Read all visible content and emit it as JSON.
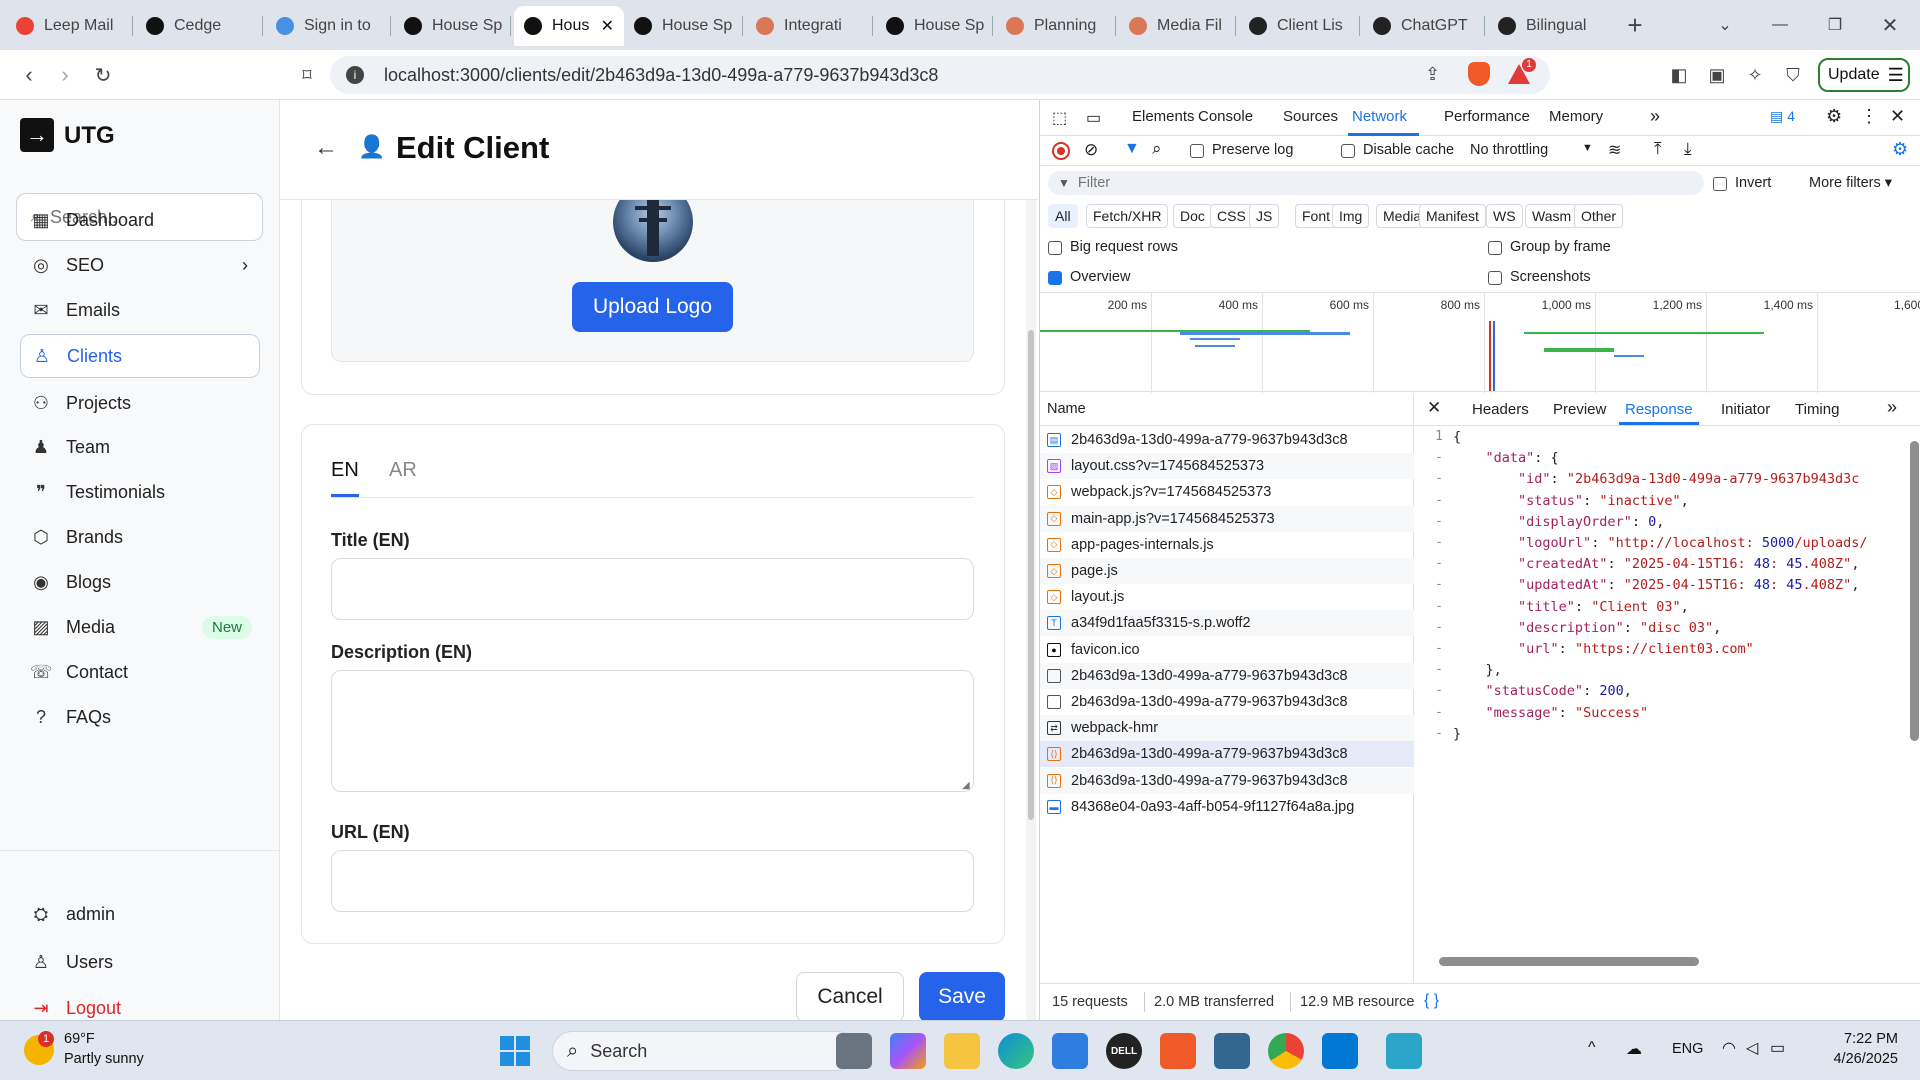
{
  "browser": {
    "tabs": [
      {
        "label": "Leep Mail",
        "icon": "gmail-icon"
      },
      {
        "label": "Cedge",
        "icon": "vercel-icon"
      },
      {
        "label": "Sign in to",
        "icon": "cloud-icon"
      },
      {
        "label": "House Sp",
        "icon": "vercel-icon"
      },
      {
        "label": "Hous",
        "icon": "vercel-icon",
        "active": true
      },
      {
        "label": "House Sp",
        "icon": "vercel-icon"
      },
      {
        "label": "Integrati",
        "icon": "claude-icon"
      },
      {
        "label": "House Sp",
        "icon": "vercel-icon"
      },
      {
        "label": "Planning",
        "icon": "claude-icon"
      },
      {
        "label": "Media Fil",
        "icon": "claude-icon"
      },
      {
        "label": "Client Lis",
        "icon": "openai-icon"
      },
      {
        "label": "ChatGPT",
        "icon": "openai-icon"
      },
      {
        "label": "Bilingual",
        "icon": "openai-icon"
      }
    ],
    "url": "localhost:3000/clients/edit/2b463d9a-13d0-499a-a779-9637b943d3c8",
    "update_label": "Update",
    "brave_badge": "1"
  },
  "sidebar": {
    "brand": "UTG",
    "search_placeholder": "Search...",
    "items": [
      {
        "label": "Dashboard",
        "icon": "grid-icon"
      },
      {
        "label": "SEO",
        "icon": "globe-icon"
      },
      {
        "label": "Emails",
        "icon": "mail-icon"
      },
      {
        "label": "Clients",
        "icon": "user-icon"
      },
      {
        "label": "Projects",
        "icon": "projects-icon"
      },
      {
        "label": "Team",
        "icon": "team-icon"
      },
      {
        "label": "Testimonials",
        "icon": "quote-icon"
      },
      {
        "label": "Brands",
        "icon": "box-icon"
      },
      {
        "label": "Blogs",
        "icon": "rss-icon"
      },
      {
        "label": "Media",
        "icon": "image-icon",
        "badge": "New"
      },
      {
        "label": "Contact",
        "icon": "contact-icon"
      },
      {
        "label": "FAQs",
        "icon": "help-icon"
      }
    ],
    "bottom": [
      {
        "label": "admin",
        "icon": "admin-icon"
      },
      {
        "label": "Users",
        "icon": "users-icon"
      },
      {
        "label": "Logout",
        "icon": "logout-icon"
      }
    ]
  },
  "main": {
    "title": "Edit Client",
    "upload_label": "Upload Logo",
    "lang_tabs": [
      "EN",
      "AR"
    ],
    "fields": [
      {
        "label": "Title (EN)",
        "value": ""
      },
      {
        "label": "Description (EN)",
        "value": ""
      },
      {
        "label": "URL (EN)",
        "value": ""
      }
    ],
    "cancel_label": "Cancel",
    "save_label": "Save"
  },
  "devtools": {
    "tabs": [
      "Elements",
      "Console",
      "Sources",
      "Network",
      "Performance",
      "Memory"
    ],
    "active_tab": "Network",
    "issues_count": "4",
    "preserve_log": "Preserve log",
    "disable_cache": "Disable cache",
    "throttling": "No throttling",
    "filter_placeholder": "Filter",
    "invert": "Invert",
    "more_filters": "More filters",
    "type_chips": [
      "All",
      "Fetch/XHR",
      "Doc",
      "CSS",
      "JS",
      "Font",
      "Img",
      "Media",
      "Manifest",
      "WS",
      "Wasm",
      "Other"
    ],
    "big_rows": "Big request rows",
    "group_by_frame": "Group by frame",
    "overview": "Overview",
    "screenshots": "Screenshots",
    "timeline_ticks": [
      "200 ms",
      "400 ms",
      "600 ms",
      "800 ms",
      "1,000 ms",
      "1,200 ms",
      "1,400 ms",
      "1,600"
    ],
    "name_header": "Name",
    "requests": [
      {
        "name": "2b463d9a-13d0-499a-a779-9637b943d3c8",
        "kind": "doc"
      },
      {
        "name": "layout.css?v=1745684525373",
        "kind": "css"
      },
      {
        "name": "webpack.js?v=1745684525373",
        "kind": "js"
      },
      {
        "name": "main-app.js?v=1745684525373",
        "kind": "js"
      },
      {
        "name": "app-pages-internals.js",
        "kind": "js"
      },
      {
        "name": "page.js",
        "kind": "js"
      },
      {
        "name": "layout.js",
        "kind": "js"
      },
      {
        "name": "a34f9d1faa5f3315-s.p.woff2",
        "kind": "font"
      },
      {
        "name": "favicon.ico",
        "kind": "ico"
      },
      {
        "name": "2b463d9a-13d0-499a-a779-9637b943d3c8",
        "kind": "other"
      },
      {
        "name": "2b463d9a-13d0-499a-a779-9637b943d3c8",
        "kind": "other"
      },
      {
        "name": "webpack-hmr",
        "kind": "ws"
      },
      {
        "name": "2b463d9a-13d0-499a-a779-9637b943d3c8",
        "kind": "xhr",
        "selected": true
      },
      {
        "name": "2b463d9a-13d0-499a-a779-9637b943d3c8",
        "kind": "xhr"
      },
      {
        "name": "84368e04-0a93-4aff-b054-9f1127f64a8a.jpg",
        "kind": "img"
      }
    ],
    "detail_tabs": [
      "Headers",
      "Preview",
      "Response",
      "Initiator",
      "Timing"
    ],
    "active_detail": "Response",
    "response_lines": [
      "{",
      "    \"data\": {",
      "        \"id\": \"2b463d9a-13d0-499a-a779-9637b943d3c",
      "        \"status\": \"inactive\",",
      "        \"displayOrder\": 0,",
      "        \"logoUrl\": \"http://localhost:5000/uploads/",
      "        \"createdAt\": \"2025-04-15T16:48:45.408Z\",",
      "        \"updatedAt\": \"2025-04-15T16:48:45.408Z\",",
      "        \"title\": \"Client 03\",",
      "        \"description\": \"disc 03\",",
      "        \"url\": \"https://client03.com\"",
      "    },",
      "    \"statusCode\": 200,",
      "    \"message\": \"Success\"",
      "}"
    ],
    "line_numbers": [
      "1",
      "-",
      "-",
      "-",
      "-",
      "-",
      "-",
      "-",
      "-",
      "-",
      "-",
      "-",
      "-",
      "-",
      "-"
    ],
    "status_requests": "15 requests",
    "status_transferred": "2.0 MB transferred",
    "status_resources": "12.9 MB resource"
  },
  "taskbar": {
    "temp": "69°F",
    "weather": "Partly sunny",
    "weather_badge": "1",
    "search": "Search",
    "lang": "ENG",
    "time": "7:22 PM",
    "date": "4/26/2025"
  }
}
